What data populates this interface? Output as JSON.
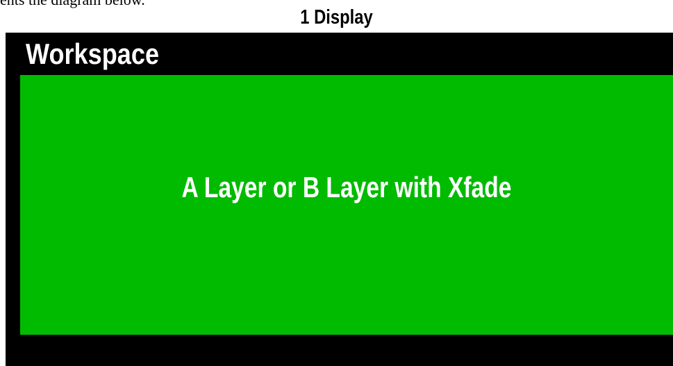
{
  "caption_fragment": "ents the diagram below.",
  "display": {
    "title": "1 Display",
    "workspace_label": "Workspace",
    "layer_text": "A Layer or B Layer with Xfade"
  },
  "colors": {
    "frame": "#000000",
    "workspace_fill": "#00bb00",
    "text": "#ffffff"
  }
}
